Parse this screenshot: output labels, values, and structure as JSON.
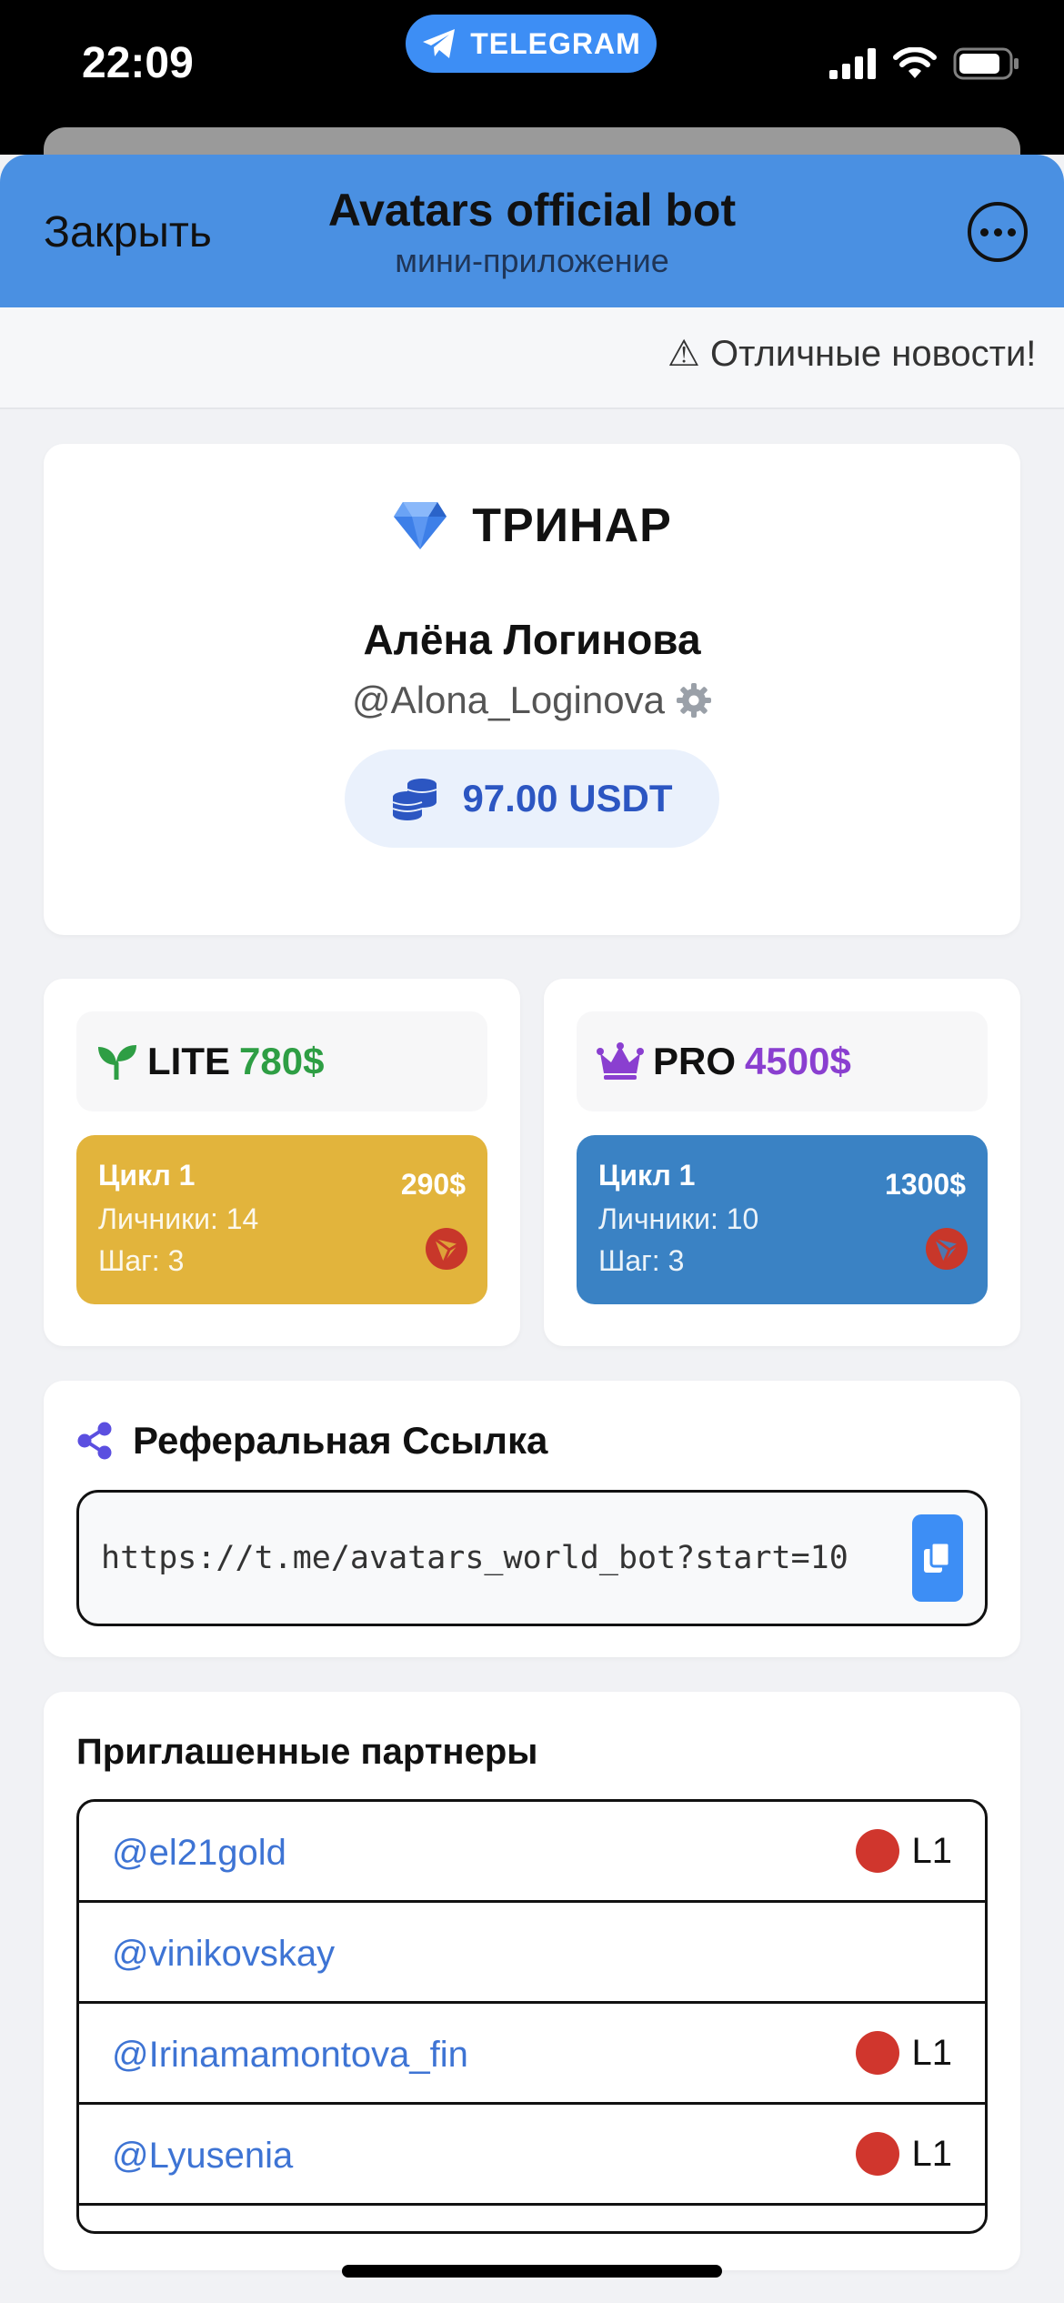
{
  "status_bar": {
    "time": "22:09",
    "pill_label": "TELEGRAM"
  },
  "header": {
    "close_label": "Закрыть",
    "title": "Avatars official bot",
    "subtitle": "мини-приложение"
  },
  "ticker": {
    "text": "⚠ Отличные новости!"
  },
  "profile": {
    "brand": "ТРИНАР",
    "name": "Алёна Логинова",
    "handle": "@Alona_Loginova",
    "balance": "97.00 USDT"
  },
  "plans": [
    {
      "name": "LITE",
      "price": "780$",
      "price_color": "#2e9e44",
      "box_color": "#e2b43c",
      "cycle": "Цикл 1",
      "personal": "Личники: 14",
      "step": "Шаг: 3",
      "amount": "290$"
    },
    {
      "name": "PRO",
      "price": "4500$",
      "price_color": "#8a3fd0",
      "box_color": "#3a82c4",
      "cycle": "Цикл 1",
      "personal": "Личники: 10",
      "step": "Шаг: 3",
      "amount": "1300$"
    }
  ],
  "referral": {
    "title": "Реферальная Ссылка",
    "url": "https://t.me/avatars_world_bot?start=10"
  },
  "partners": {
    "title": "Приглашенные партнеры",
    "items": [
      {
        "handle": "@el21gold",
        "level": "L1"
      },
      {
        "handle": "@vinikovskay",
        "level": ""
      },
      {
        "handle": "@Irinamamontova_fin",
        "level": "L1"
      },
      {
        "handle": "@Lyusenia",
        "level": "L1"
      }
    ]
  },
  "colors": {
    "header_bg": "#4a90e2",
    "accent": "#3d8ef5",
    "level_dot": "#d0362d"
  }
}
